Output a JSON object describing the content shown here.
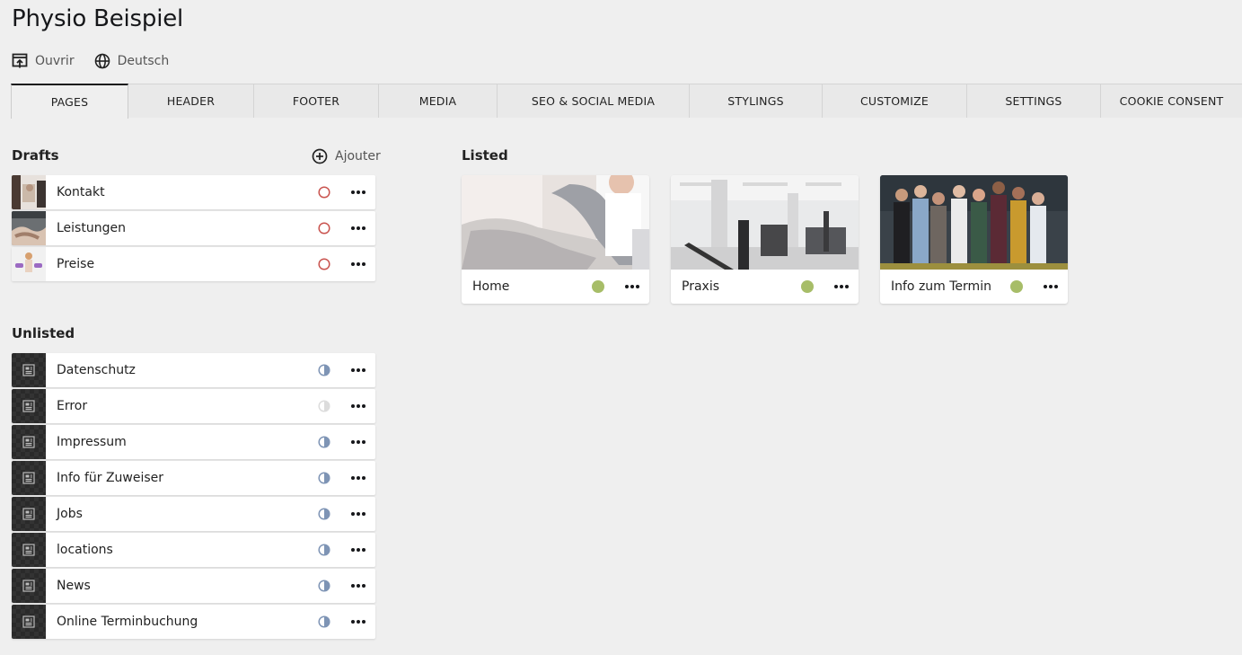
{
  "title": "Physio Beispiel",
  "actions": {
    "open": "Ouvrir",
    "language": "Deutsch"
  },
  "tabs": [
    "PAGES",
    "HEADER",
    "FOOTER",
    "MEDIA",
    "SEO & SOCIAL MEDIA",
    "STYLINGS",
    "CUSTOMIZE",
    "SETTINGS",
    "COOKIE CONSENT"
  ],
  "drafts": {
    "heading": "Drafts",
    "add_label": "Ajouter",
    "items": [
      "Kontakt",
      "Leistungen",
      "Preise"
    ]
  },
  "unlisted": {
    "heading": "Unlisted",
    "items": [
      "Datenschutz",
      "Error",
      "Impressum",
      "Info für Zuweiser",
      "Jobs",
      "locations",
      "News",
      "Online Terminbuchung"
    ]
  },
  "listed": {
    "heading": "Listed",
    "items": [
      "Home",
      "Praxis",
      "Info zum Termin"
    ]
  },
  "colors": {
    "draft_status": "#c9534e",
    "unlisted_status": "#7e94b5",
    "listed_status": "#a7bd68",
    "error_status": "#dcdcdc"
  }
}
